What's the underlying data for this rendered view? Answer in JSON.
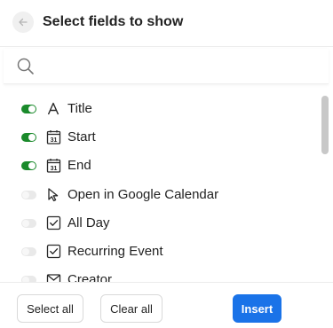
{
  "header": {
    "title": "Select fields to show",
    "back_icon": "arrow-left-icon"
  },
  "search": {
    "placeholder": "",
    "value": "",
    "icon": "search-icon"
  },
  "fields": [
    {
      "label": "Title",
      "enabled": true,
      "icon": "text-font-icon"
    },
    {
      "label": "Start",
      "enabled": true,
      "icon": "calendar-31-icon"
    },
    {
      "label": "End",
      "enabled": true,
      "icon": "calendar-31-icon"
    },
    {
      "label": "Open in Google Calendar",
      "enabled": false,
      "icon": "cursor-pointer-icon"
    },
    {
      "label": "All Day",
      "enabled": false,
      "icon": "checkbox-icon"
    },
    {
      "label": "Recurring Event",
      "enabled": false,
      "icon": "checkbox-icon"
    },
    {
      "label": "Creator",
      "enabled": false,
      "icon": "mail-icon"
    }
  ],
  "calendar_icon_text": "31",
  "footer": {
    "select_all": "Select all",
    "clear_all": "Clear all",
    "insert": "Insert"
  },
  "colors": {
    "toggle_on": "#1a8a2b",
    "primary": "#1a73e8"
  }
}
